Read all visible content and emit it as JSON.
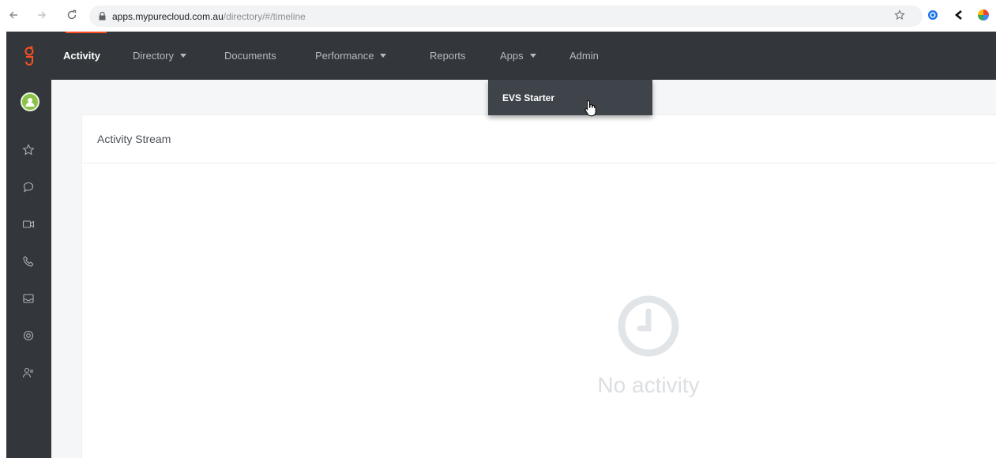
{
  "browser": {
    "url_host": "apps.mypurecloud.com.au",
    "url_path": "/directory/#/timeline"
  },
  "topnav": {
    "items": [
      {
        "label": "Activity",
        "active": true,
        "has_caret": false
      },
      {
        "label": "Directory",
        "active": false,
        "has_caret": true
      },
      {
        "label": "Documents",
        "active": false,
        "has_caret": false
      },
      {
        "label": "Performance",
        "active": false,
        "has_caret": true
      },
      {
        "label": "Reports",
        "active": false,
        "has_caret": false
      },
      {
        "label": "Apps",
        "active": false,
        "has_caret": true
      },
      {
        "label": "Admin",
        "active": false,
        "has_caret": false
      }
    ]
  },
  "apps_menu": {
    "items": [
      {
        "label": "EVS Starter"
      }
    ]
  },
  "sidebar": {
    "icons": [
      "favorites-icon",
      "chat-icon",
      "video-icon",
      "phone-icon",
      "inbox-icon",
      "settings-icon",
      "people-icon"
    ]
  },
  "main": {
    "panel_title": "Activity Stream",
    "empty_text": "No activity"
  },
  "colors": {
    "dark_bar": "#33373c",
    "accent": "#ff4f1f",
    "avatar": "#8bc34a",
    "dropdown": "#3f444a"
  }
}
